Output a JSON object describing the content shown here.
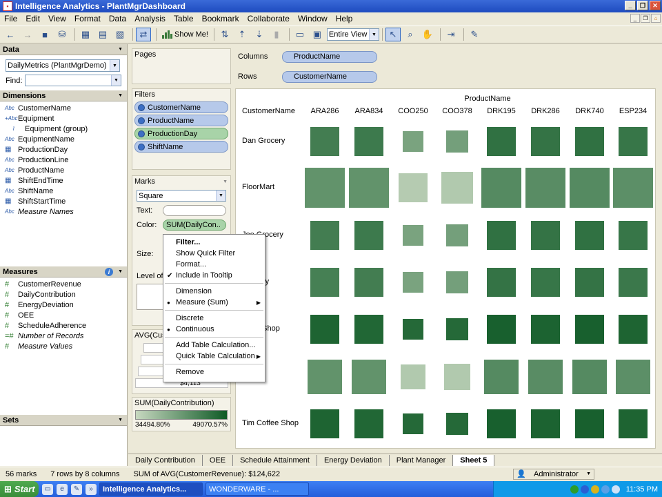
{
  "window": {
    "title": "Intelligence Analytics - PlantMgrDashboard"
  },
  "menu": [
    "File",
    "Edit",
    "View",
    "Format",
    "Data",
    "Analysis",
    "Table",
    "Bookmark",
    "Collaborate",
    "Window",
    "Help"
  ],
  "toolbar": {
    "show_me": "Show Me!",
    "fit": "Entire View"
  },
  "datapane": {
    "title": "Data",
    "datasource": "DailyMetrics (PlantMgrDemo)",
    "find_label": "Find:",
    "dimensions_title": "Dimensions",
    "dimensions": [
      {
        "icon": "Abc",
        "label": "CustomerName"
      },
      {
        "icon": "+Abc",
        "label": "Equipment"
      },
      {
        "icon": "clip",
        "label": "Equipment (group)"
      },
      {
        "icon": "Abc",
        "label": "EquipmentName"
      },
      {
        "icon": "cal",
        "label": "ProductionDay"
      },
      {
        "icon": "Abc",
        "label": "ProductionLine"
      },
      {
        "icon": "Abc",
        "label": "ProductName"
      },
      {
        "icon": "cal",
        "label": "ShiftEndTime"
      },
      {
        "icon": "Abc",
        "label": "ShiftName"
      },
      {
        "icon": "cal",
        "label": "ShiftStartTime"
      },
      {
        "icon": "Abc",
        "label": "Measure Names"
      }
    ],
    "measures_title": "Measures",
    "measures": [
      {
        "label": "CustomerRevenue"
      },
      {
        "label": "DailyContribution"
      },
      {
        "label": "EnergyDeviation"
      },
      {
        "label": "OEE"
      },
      {
        "label": "ScheduleAdherence"
      },
      {
        "label": "Number of Records"
      },
      {
        "label": "Measure Values"
      }
    ],
    "sets_title": "Sets"
  },
  "shelves": {
    "pages": "Pages",
    "filters_title": "Filters",
    "filters": [
      "CustomerName",
      "ProductName",
      "ProductionDay",
      "ShiftName"
    ],
    "marks_title": "Marks",
    "mark_type": "Square",
    "text_label": "Text:",
    "color_label": "Color:",
    "color_pill": "SUM(DailyCon..",
    "size_label": "Size:",
    "lod_label": "Level of",
    "size_legend_title": "AVG(Cust",
    "size_legend_value": "$4,113",
    "color_legend_title": "SUM(DailyContribution)",
    "color_min": "34494.80%",
    "color_max": "49070.57%",
    "columns_label": "Columns",
    "columns_pill": "ProductName",
    "rows_label": "Rows",
    "rows_pill": "CustomerName"
  },
  "viz": {
    "col_title": "ProductName",
    "row_title": "CustomerName",
    "columns": [
      "ARA286",
      "ARA834",
      "COO250",
      "COO378",
      "DRK195",
      "DRK286",
      "DRK740",
      "ESP234"
    ],
    "rows": [
      "Dan Grocery",
      "FloorMart",
      "Joe Grocery",
      "Grocery",
      "Coffe Shop",
      "p",
      "Tim Coffee Shop"
    ]
  },
  "chart_data": {
    "type": "heatmap",
    "x": [
      "ARA286",
      "ARA834",
      "COO250",
      "COO378",
      "DRK195",
      "DRK286",
      "DRK740",
      "ESP234"
    ],
    "y": [
      "Dan Grocery",
      "FloorMart",
      "Joe Grocery",
      "Grocery",
      "Coffe Shop",
      "p",
      "Tim Coffee Shop"
    ],
    "size_values": [
      [
        0.72,
        0.72,
        0.52,
        0.55,
        0.72,
        0.72,
        0.72,
        0.72
      ],
      [
        1.0,
        1.0,
        0.73,
        0.78,
        1.0,
        1.0,
        1.0,
        1.0
      ],
      [
        0.72,
        0.72,
        0.52,
        0.55,
        0.72,
        0.72,
        0.72,
        0.72
      ],
      [
        0.72,
        0.72,
        0.52,
        0.55,
        0.72,
        0.72,
        0.72,
        0.72
      ],
      [
        0.72,
        0.72,
        0.52,
        0.55,
        0.72,
        0.72,
        0.72,
        0.72
      ],
      [
        0.85,
        0.85,
        0.62,
        0.66,
        0.85,
        0.85,
        0.85,
        0.85
      ],
      [
        0.72,
        0.72,
        0.52,
        0.55,
        0.72,
        0.72,
        0.72,
        0.72
      ]
    ],
    "color_values": [
      [
        0.72,
        0.75,
        0.42,
        0.45,
        0.82,
        0.8,
        0.82,
        0.78
      ],
      [
        0.55,
        0.55,
        0.1,
        0.12,
        0.62,
        0.6,
        0.62,
        0.58
      ],
      [
        0.72,
        0.75,
        0.42,
        0.45,
        0.82,
        0.8,
        0.82,
        0.78
      ],
      [
        0.7,
        0.72,
        0.42,
        0.45,
        0.8,
        0.78,
        0.8,
        0.76
      ],
      [
        0.92,
        0.9,
        0.88,
        0.88,
        0.95,
        0.93,
        0.95,
        0.92
      ],
      [
        0.55,
        0.55,
        0.12,
        0.12,
        0.62,
        0.6,
        0.62,
        0.58
      ],
      [
        0.92,
        0.9,
        0.88,
        0.88,
        0.95,
        0.93,
        0.95,
        0.92
      ]
    ],
    "color_range_labels": [
      "34494.80%",
      "49070.57%"
    ],
    "color_low": "#c7d8c0",
    "color_high": "#0f5a26"
  },
  "context_menu": {
    "items": [
      {
        "label": "Filter...",
        "bold": true
      },
      {
        "label": "Show Quick Filter"
      },
      {
        "label": "Format..."
      },
      {
        "label": "Include in Tooltip",
        "check": true
      },
      {
        "sep": true
      },
      {
        "label": "Dimension"
      },
      {
        "label": "Measure (Sum)",
        "dot": true,
        "sub": true
      },
      {
        "sep": true
      },
      {
        "label": "Discrete"
      },
      {
        "label": "Continuous",
        "dot": true
      },
      {
        "sep": true
      },
      {
        "label": "Add Table Calculation..."
      },
      {
        "label": "Quick Table Calculation",
        "sub": true
      },
      {
        "sep": true
      },
      {
        "label": "Remove"
      }
    ]
  },
  "tabs": [
    "Daily Contribution",
    "OEE",
    "Schedule Attainment",
    "Energy Deviation",
    "Plant Manager",
    "Sheet 5"
  ],
  "active_tab": "Sheet 5",
  "status": {
    "marks": "56 marks",
    "dims": "7 rows by 8 columns",
    "sum": "SUM of AVG(CustomerRevenue): $124,622",
    "user": "Administrator"
  },
  "taskbar": {
    "start": "Start",
    "task1": "Intelligence Analytics...",
    "task2": "WONDERWARE - ...",
    "clock": "11:35 PM"
  }
}
